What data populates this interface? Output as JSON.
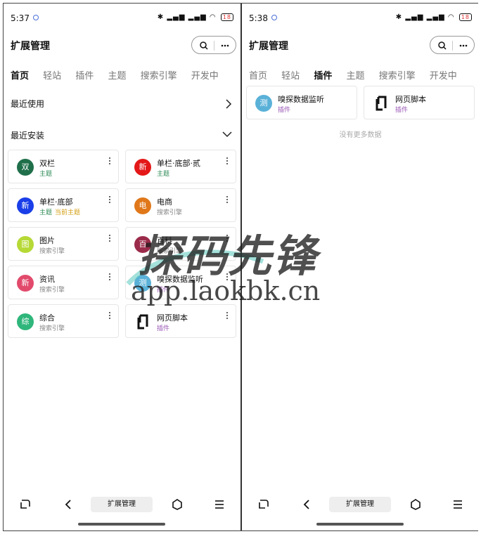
{
  "left": {
    "status": {
      "time": "5:37",
      "battery": "18"
    },
    "header": {
      "title": "扩展管理"
    },
    "tabs": [
      "首页",
      "轻站",
      "插件",
      "主题",
      "搜索引擎",
      "开发中"
    ],
    "active_tab": "首页",
    "recent_used": {
      "label": "最近使用"
    },
    "recent_installed": {
      "label": "最近安装"
    },
    "cards": [
      {
        "avatar": "双",
        "color": "#1f6f4a",
        "name": "双栏",
        "sub": "主题",
        "sub_kind": "theme",
        "extra": ""
      },
      {
        "avatar": "新",
        "color": "#e41818",
        "name": "单栏·底部·贰",
        "sub": "主题",
        "sub_kind": "theme",
        "extra": ""
      },
      {
        "avatar": "新",
        "color": "#1a3ee8",
        "name": "单栏·底部",
        "sub": "主题",
        "sub_kind": "theme",
        "extra": "当前主题"
      },
      {
        "avatar": "电",
        "color": "#e0781a",
        "name": "电商",
        "sub": "搜索引擎",
        "sub_kind": "search",
        "extra": ""
      },
      {
        "avatar": "图",
        "color": "#b6d936",
        "name": "图片",
        "sub": "搜索引擎",
        "sub_kind": "search",
        "extra": ""
      },
      {
        "avatar": "百",
        "color": "#9b2b4a",
        "name": "百科",
        "sub": "搜索引擎",
        "sub_kind": "search",
        "extra": ""
      },
      {
        "avatar": "新",
        "color": "#e24a6c",
        "name": "资讯",
        "sub": "搜索引擎",
        "sub_kind": "search",
        "extra": ""
      },
      {
        "avatar": "测",
        "color": "#5ab1d8",
        "name": "嗅探数据监听",
        "sub": "插件",
        "sub_kind": "plugin",
        "extra": ""
      },
      {
        "avatar": "综",
        "color": "#2fb67b",
        "name": "综合",
        "sub": "搜索引擎",
        "sub_kind": "search",
        "extra": ""
      },
      {
        "avatar": "",
        "color": "#ffffff",
        "name": "网页脚本",
        "sub": "插件",
        "sub_kind": "plugin",
        "extra": "",
        "icon": "script-icon"
      }
    ],
    "nav": {
      "pill_label": "扩展管理"
    }
  },
  "right": {
    "status": {
      "time": "5:38",
      "battery": "18"
    },
    "header": {
      "title": "扩展管理"
    },
    "tabs": [
      "首页",
      "轻站",
      "插件",
      "主题",
      "搜索引擎",
      "开发中"
    ],
    "active_tab": "插件",
    "cards": [
      {
        "avatar": "测",
        "color": "#5ab1d8",
        "name": "嗅探数据监听",
        "sub": "插件",
        "sub_kind": "plugin"
      },
      {
        "avatar": "",
        "color": "#ffffff",
        "name": "网页脚本",
        "sub": "插件",
        "sub_kind": "plugin",
        "icon": "script-icon"
      }
    ],
    "empty_note": "没有更多数据",
    "nav": {
      "pill_label": "扩展管理"
    }
  },
  "watermark": {
    "brand": "探码先锋",
    "url": "app.laokbk.cn"
  }
}
